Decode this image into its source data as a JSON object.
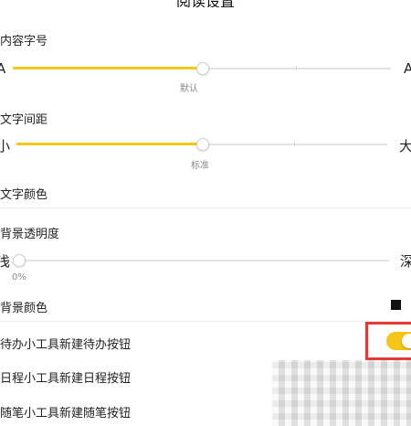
{
  "header": {
    "title": "阅读设置"
  },
  "font_size": {
    "label": "内容字号",
    "min_label": "A",
    "max_label": "A",
    "value_label": "默认",
    "value_fraction": 0.5
  },
  "letter_spacing": {
    "label": "文字间距",
    "min_label": "小",
    "max_label": "大",
    "value_label": "标准",
    "value_fraction": 0.5
  },
  "text_color": {
    "label": "文字颜色"
  },
  "bg_opacity": {
    "label": "背景透明度",
    "min_label": "浅",
    "max_label": "深",
    "value_label": "0%",
    "value_fraction": 0.0
  },
  "bg_color": {
    "label": "背景颜色",
    "swatch_color": "#111111"
  },
  "toggles": [
    {
      "label": "待办小工具新建待办按钮",
      "on": true
    },
    {
      "label": "日程小工具新建日程按钮"
    },
    {
      "label": "随笔小工具新建随笔按钮"
    }
  ],
  "colors": {
    "accent": "#f5c518",
    "highlight": "#e53935"
  }
}
